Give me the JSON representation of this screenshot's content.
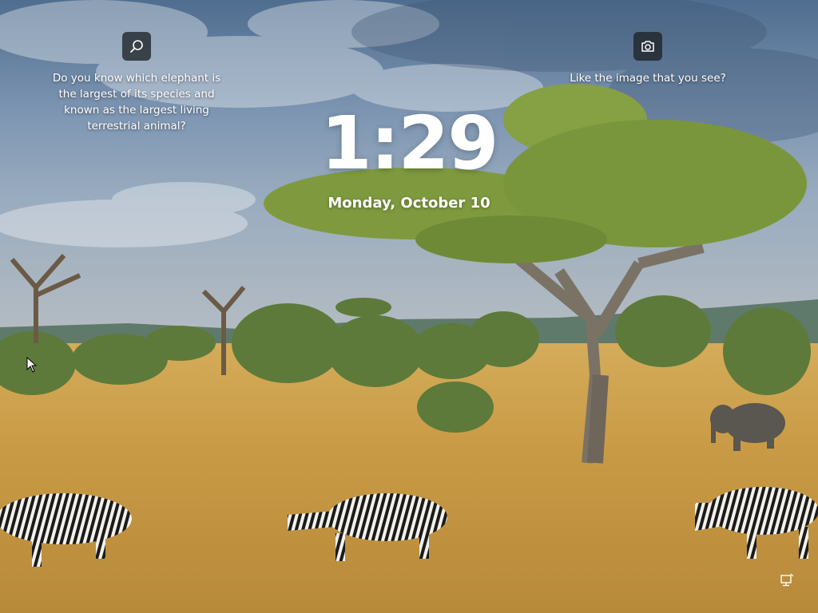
{
  "lockscreen": {
    "time": "1:29",
    "date": "Monday, October 10"
  },
  "spotlight": {
    "search": {
      "icon": "search-icon",
      "text": "Do you know which elephant is the largest of its species and known as the largest living terrestrial animal?"
    },
    "camera": {
      "icon": "camera-icon",
      "text": "Like the image that you see?"
    }
  },
  "status": {
    "network_icon": "network-icon"
  },
  "colors": {
    "sky": "#5f7c9c",
    "grass": "#c9a04a",
    "tree_canopy": "#7f9a3e",
    "button_bg": "#262a30"
  }
}
